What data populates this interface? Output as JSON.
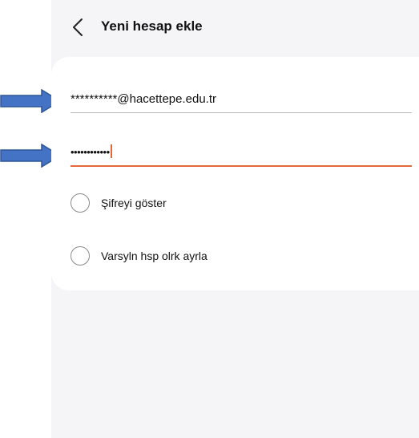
{
  "header": {
    "back_icon": "chevron-left-icon",
    "title": "Yeni hesap ekle"
  },
  "form": {
    "email_value": "**********@hacettepe.edu.tr",
    "password_value": "••••••••••••",
    "password_underline_color": "#e4683a",
    "options": [
      {
        "label": "Şifreyi göster",
        "checked": false
      },
      {
        "label": "Varsyln hsp olrk ayrla",
        "checked": false
      }
    ]
  },
  "annotations": {
    "arrow_color": "#4472c4",
    "arrow_icon": "right-arrow-icon"
  }
}
